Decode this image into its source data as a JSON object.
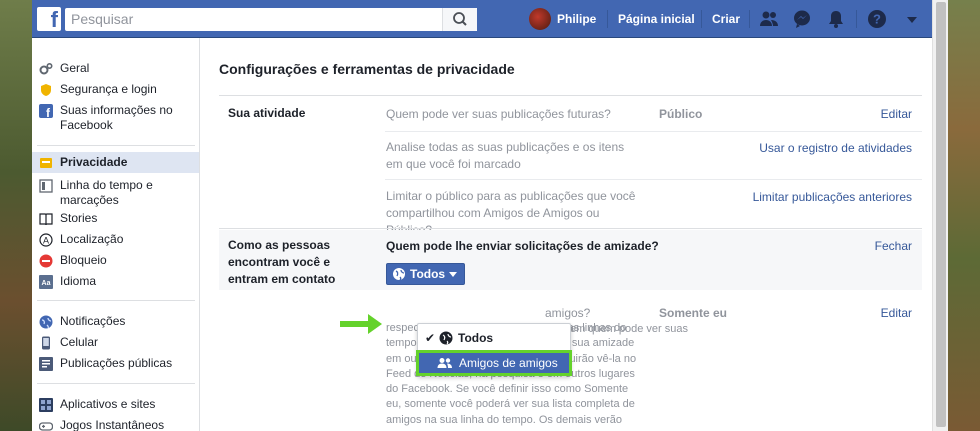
{
  "topbar": {
    "search_placeholder": "Pesquisar",
    "user_name": "Philipe",
    "home": "Página inicial",
    "create": "Criar"
  },
  "sidebar": {
    "items": [
      {
        "label": "Geral",
        "icon": "gears-icon"
      },
      {
        "label": "Segurança e login",
        "icon": "shield-icon"
      },
      {
        "label": "Suas informações no Facebook",
        "icon": "facebook-icon"
      },
      {
        "label": "Privacidade",
        "icon": "lock-icon",
        "active": true
      },
      {
        "label": "Linha do tempo e marcações",
        "icon": "timeline-icon"
      },
      {
        "label": "Stories",
        "icon": "book-icon"
      },
      {
        "label": "Localização",
        "icon": "location-icon"
      },
      {
        "label": "Bloqueio",
        "icon": "block-icon"
      },
      {
        "label": "Idioma",
        "icon": "language-icon"
      },
      {
        "label": "Notificações",
        "icon": "globe-icon"
      },
      {
        "label": "Celular",
        "icon": "phone-icon"
      },
      {
        "label": "Publicações públicas",
        "icon": "rss-icon"
      },
      {
        "label": "Aplicativos e sites",
        "icon": "apps-icon"
      },
      {
        "label": "Jogos Instantâneos",
        "icon": "gamepad-icon"
      }
    ]
  },
  "main": {
    "title": "Configurações e ferramentas de privacidade",
    "section1": {
      "title": "Sua atividade",
      "rows": [
        {
          "question": "Quem pode ver suas publicações futuras?",
          "value": "Público",
          "action": "Editar"
        },
        {
          "question": "Analise todas as suas publicações e os itens em que você foi marcado",
          "value": "",
          "action": "Usar o registro de atividades"
        },
        {
          "question": "Limitar o público para as publicações que você compartilhou com Amigos de Amigos ou Público?",
          "value": "",
          "action": "Limitar publicações anteriores"
        }
      ]
    },
    "section2": {
      "title": "Como as pessoas encontram você e entram em contato",
      "expanded_question": "Quem pode lhe enviar solicitações de amizade?",
      "close": "Fechar",
      "selector_label": "Todos",
      "next_question_tail": "amigos?",
      "next_value": "Somente eu",
      "next_action": "Editar",
      "description_line1_tail": "em quem pode ver suas",
      "description_rest": "respectivas amizades em suas próprias linhas do tempo. Se as pessoas puderem ver a sua amizade em outra linha do tempo, elas conseguirão vê-la no Feed de Notícias, na pesquisa e em outros lugares do Facebook. Se você definir isso como Somente eu, somente você poderá ver sua lista completa de amigos na sua linha do tempo. Os demais verão apenas"
    },
    "dropdown": {
      "options": [
        "Todos",
        "Amigos de amigos"
      ],
      "checked": "Todos",
      "highlighted": "Amigos de amigos"
    }
  },
  "colors": {
    "brand": "#4267b2",
    "highlight_outline": "#64d22b",
    "link": "#365899"
  }
}
